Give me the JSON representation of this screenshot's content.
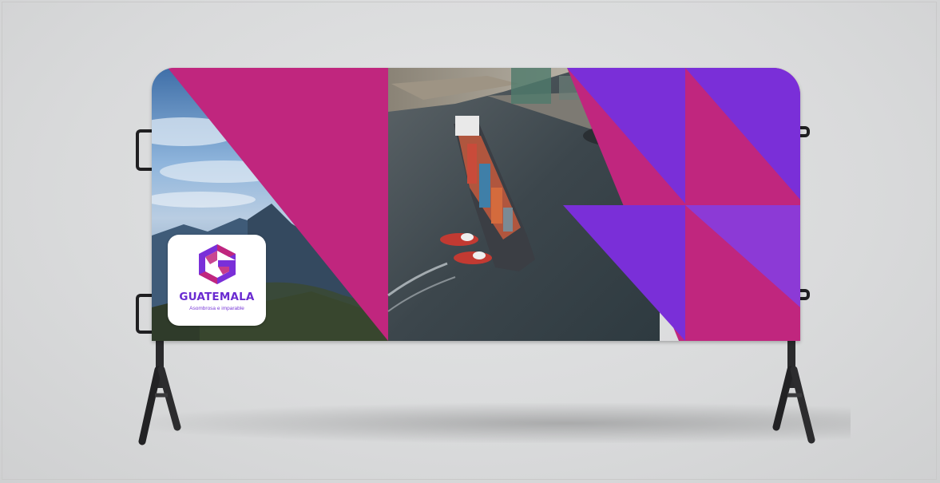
{
  "image": {
    "description_free": true
  },
  "logo": {
    "wordmark": "GUATEMALA",
    "tagline": "Asombrosa e imparable",
    "icon": "guatemala-g-icon"
  },
  "colors": {
    "magenta": "#c0267e",
    "purple": "#7a2fd8",
    "violet": "#8c3ad6",
    "water": "#3e4a52",
    "sky": "#6f9ccc",
    "metal": "#2a2a2c",
    "backdrop": "#dcdddd"
  }
}
